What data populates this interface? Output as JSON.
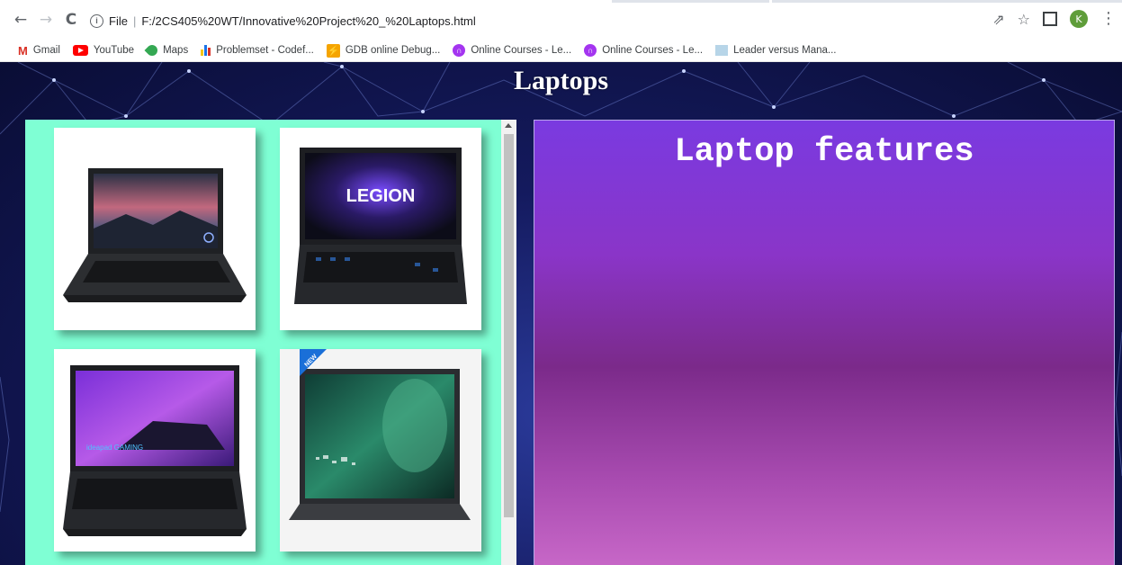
{
  "browser": {
    "back_icon": "arrow-left-icon",
    "forward_icon": "arrow-right-icon",
    "reload_icon": "reload-icon",
    "scheme_label": "File",
    "url": "F:/2CS405%20WT/Innovative%20Project%20_%20Laptops.html",
    "profile_initial": "K"
  },
  "bookmarks": [
    {
      "label": "Gmail",
      "icon": "gmail-icon"
    },
    {
      "label": "YouTube",
      "icon": "youtube-icon"
    },
    {
      "label": "Maps",
      "icon": "maps-icon"
    },
    {
      "label": "Problemset - Codef...",
      "icon": "codeforces-icon"
    },
    {
      "label": "GDB online Debug...",
      "icon": "gdb-icon"
    },
    {
      "label": "Online Courses - Le...",
      "icon": "udemy-icon"
    },
    {
      "label": "Online Courses - Le...",
      "icon": "udemy-icon"
    },
    {
      "label": "Leader versus Mana...",
      "icon": "document-icon"
    }
  ],
  "page": {
    "title": "Laptops",
    "features_heading": "Laptop features",
    "gallery_images": [
      {
        "name": "laptop-image-gaming-dark",
        "badge": ""
      },
      {
        "name": "laptop-image-legion",
        "badge": "LEGION"
      },
      {
        "name": "laptop-image-ideapad-gaming",
        "badge": "ideapad GAMING"
      },
      {
        "name": "laptop-image-new-green",
        "badge": "NEW"
      }
    ]
  },
  "colors": {
    "gallery_bg": "#7fffd4",
    "features_top": "#7a3ae0",
    "features_bottom": "#c868c8"
  }
}
